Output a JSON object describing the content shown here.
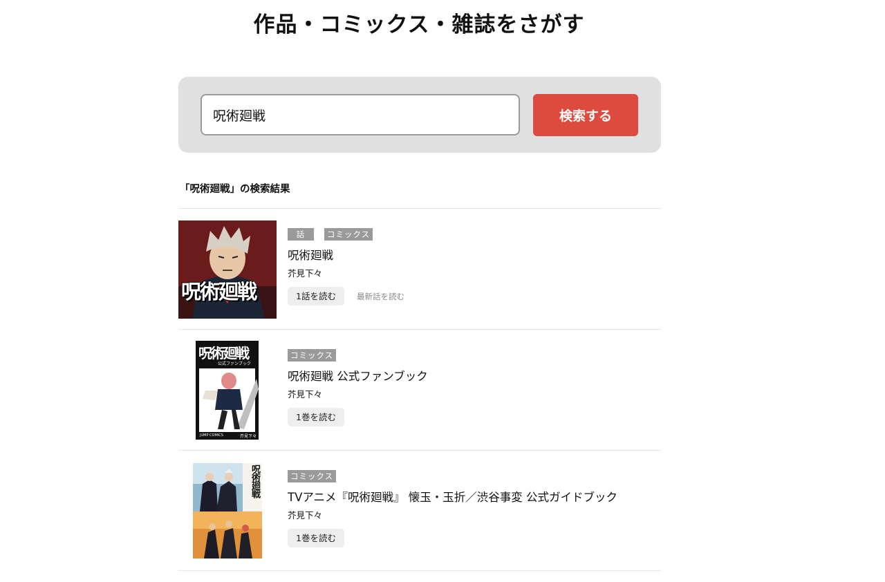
{
  "page": {
    "title": "作品・コミックス・雑誌をさがす"
  },
  "search": {
    "value": "呪術廻戦",
    "button_label": "検索する"
  },
  "results_heading": "「呪術廻戦」の検索結果",
  "results": [
    {
      "tags": [
        "話",
        "コミックス"
      ],
      "title": "呪術廻戦",
      "author": "芥見下々",
      "read_label": "1話を読む",
      "latest_label": "最新話を読む",
      "cover_text": "呪術廻戦"
    },
    {
      "tags": [
        "コミックス"
      ],
      "title": "呪術廻戦 公式ファンブック",
      "author": "芥見下々",
      "read_label": "1巻を読む",
      "cover_text": "呪術廻戦",
      "cover_subtext": "公式ファンブック",
      "cover_footer_left": "JUMP COMICS",
      "cover_footer_right": "芥見下々"
    },
    {
      "tags": [
        "コミックス"
      ],
      "title": "TVアニメ『呪術廻戦』 懐玉・玉折／渋谷事変 公式ガイドブック",
      "author": "芥見下々",
      "read_label": "1巻を読む",
      "cover_text": "呪術廻戦"
    }
  ],
  "colors": {
    "accent": "#dc4b3e",
    "tag_bg": "#9a9a9a",
    "panel_bg": "#e0e0e0"
  }
}
